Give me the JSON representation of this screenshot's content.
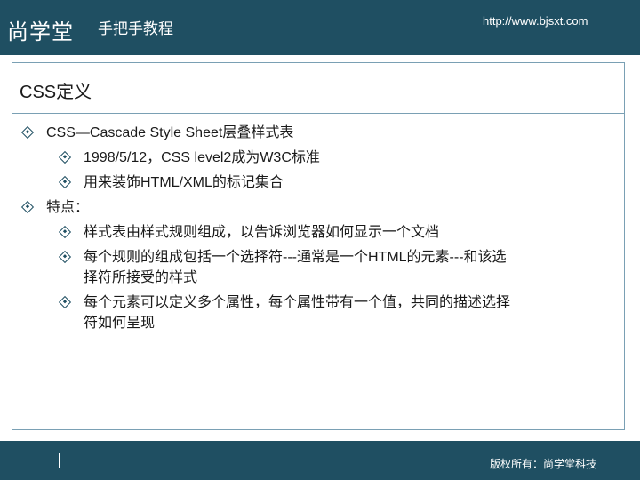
{
  "header": {
    "brand": "尚学堂",
    "slogan": "手把手教程",
    "url": "http://www.bjsxt.com"
  },
  "slide": {
    "title": "CSS定义",
    "bullets": [
      {
        "level": 1,
        "lines": [
          "CSS—Cascade Style Sheet层叠样式表"
        ]
      },
      {
        "level": 2,
        "lines": [
          "1998/5/12，CSS level2成为W3C标准"
        ]
      },
      {
        "level": 2,
        "lines": [
          "用来装饰HTML/XML的标记集合"
        ]
      },
      {
        "level": 1,
        "lines": [
          "特点："
        ]
      },
      {
        "level": 2,
        "lines": [
          "样式表由样式规则组成，以告诉浏览器如何显示一个文档"
        ]
      },
      {
        "level": 2,
        "lines": [
          "每个规则的组成包括一个选择符---通常是一个HTML的元素---和该选",
          "择符所接受的样式"
        ]
      },
      {
        "level": 2,
        "lines": [
          "每个元素可以定义多个属性，每个属性带有一个值，共同的描述选择",
          "符如何呈现"
        ]
      }
    ]
  },
  "footer": {
    "copyright": "版权所有：尚学堂科技"
  },
  "colors": {
    "header_bg": "#1f4f62",
    "border": "#7aa0b4",
    "bullet": "#1f4f62"
  },
  "icons": {
    "bullet": "diamond-bullet-icon"
  }
}
